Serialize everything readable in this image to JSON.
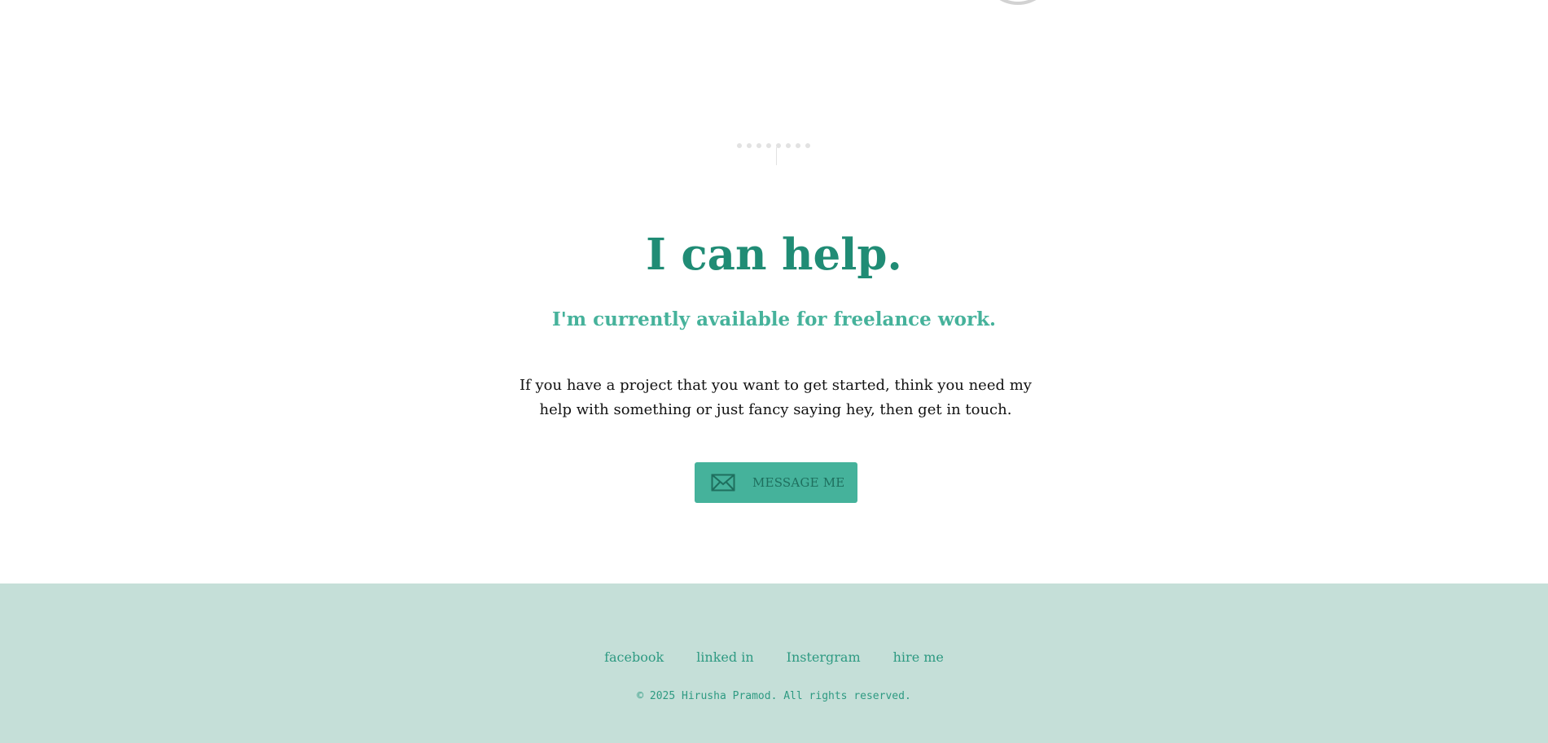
{
  "hero": {
    "title": "I can help.",
    "subtitle": "I'm currently available for freelance work.",
    "description": "If you have a project that you want to get started, think you need my help with something or just fancy saying hey, then get in touch."
  },
  "cta": {
    "icon": "envelope-icon",
    "label": "MESSAGE ME"
  },
  "footer": {
    "links": [
      {
        "label": "facebook"
      },
      {
        "label": "linked in"
      },
      {
        "label": "Instergram"
      },
      {
        "label": "hire me"
      }
    ],
    "copyright": "© 2025 Hirusha Pramod. All rights reserved."
  },
  "colors": {
    "brand": "#208c75",
    "accent": "#45b29b",
    "footer_bg": "#c5dfd8",
    "link": "#2e9a82"
  }
}
